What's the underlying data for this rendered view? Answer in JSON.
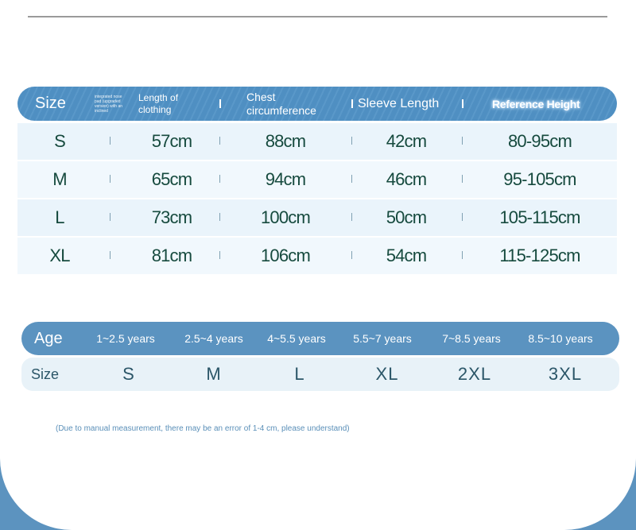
{
  "size_table": {
    "header": {
      "size": "Size",
      "tiny_note": "integrated nose pad (upgraded version) with an inclined",
      "length": "Length of clothing",
      "chest": "Chest circumference",
      "sleeve": "Sleeve Length",
      "reference_height": "Reference Height"
    },
    "rows": [
      {
        "size": "S",
        "length": "57cm",
        "chest": "88cm",
        "sleeve": "42cm",
        "height": "80-95cm"
      },
      {
        "size": "M",
        "length": "65cm",
        "chest": "94cm",
        "sleeve": "46cm",
        "height": "95-105cm"
      },
      {
        "size": "L",
        "length": "73cm",
        "chest": "100cm",
        "sleeve": "50cm",
        "height": "105-115cm"
      },
      {
        "size": "XL",
        "length": "81cm",
        "chest": "106cm",
        "sleeve": "54cm",
        "height": "115-125cm"
      }
    ]
  },
  "age_table": {
    "age_label": "Age",
    "size_label": "Size",
    "ages": [
      "1~2.5 years",
      "2.5~4 years",
      "4~5.5 years",
      "5.5~7 years",
      "7~8.5 years",
      "8.5~10 years"
    ],
    "sizes": [
      "S",
      "M",
      "L",
      "XL",
      "2XL",
      "3XL"
    ]
  },
  "note": "(Due to manual measurement, there may be an error of 1-4 cm, please understand)",
  "colors": {
    "header_blue": "#5b93c0",
    "row_bg": "#eaf4fb",
    "value_text": "#164a3e",
    "note_text": "#5a8fb8"
  }
}
